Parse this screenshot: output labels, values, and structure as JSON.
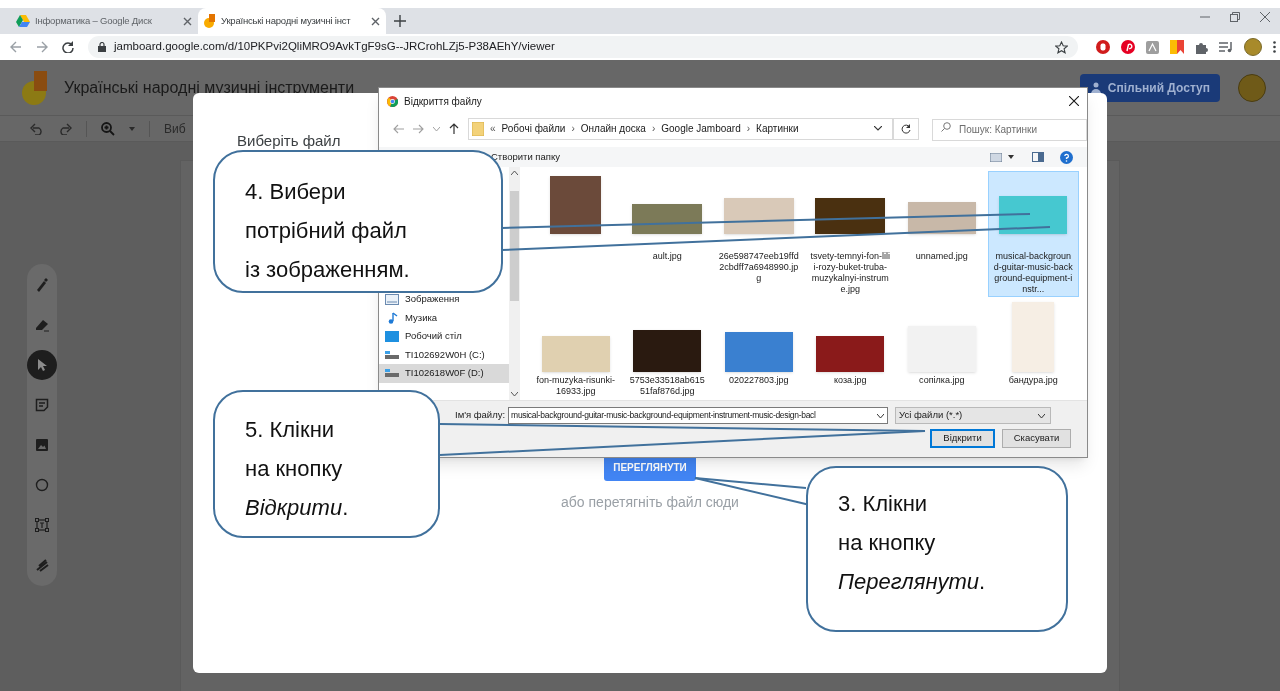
{
  "browser": {
    "tabs": [
      {
        "title": "Інформатика – Google Диск",
        "selected": false
      },
      {
        "title": "Українські народні музичні інст",
        "selected": true
      }
    ],
    "url": "jamboard.google.com/d/10PKPvi2QliMRO9AvkTgF9sG--JRCrohLZj5-P38AEhY/viewer"
  },
  "jamboard": {
    "title": "Українські народні музичні інструменти",
    "share_button": "Спільний Доступ",
    "toolbar_text": "Виб",
    "tools": [
      {
        "kind": "pen",
        "selected": false
      },
      {
        "kind": "eraser",
        "selected": false
      },
      {
        "kind": "select",
        "selected": true
      },
      {
        "kind": "note",
        "selected": false
      },
      {
        "kind": "image",
        "selected": false
      },
      {
        "kind": "shape",
        "selected": false
      },
      {
        "kind": "textbox",
        "selected": false
      },
      {
        "kind": "laser",
        "selected": false
      }
    ]
  },
  "upload_modal": {
    "title": "Виберіть файл",
    "browse_button": "ПЕРЕГЛЯНУТИ",
    "drop_hint": "або перетягніть файл сюди"
  },
  "file_dialog": {
    "title": "Відкриття файлу",
    "overflow": "«",
    "separator": "›",
    "breadcrumb": [
      "Робочі файли",
      "Онлайн доска",
      "Google Jamboard",
      "Картинки"
    ],
    "search_placeholder": "Пошук: Картинки",
    "new_folder": "Створити папку",
    "nav_items": [
      {
        "kind": "pictures",
        "label": "Зображення",
        "selected": false
      },
      {
        "kind": "music",
        "label": "Музика",
        "selected": false
      },
      {
        "kind": "desktop",
        "label": "Робочий стіл",
        "selected": false
      },
      {
        "kind": "drive",
        "label": "TI102692W0H (C:)",
        "selected": false
      },
      {
        "kind": "drive",
        "label": "TI102618W0F (D:)",
        "selected": true
      }
    ],
    "files": [
      {
        "selected": false
      },
      {
        "name": "ault.jpg",
        "selected": false
      },
      {
        "name": "26e598747eeb19ffd2cbdff7a6948990.jpg",
        "selected": false
      },
      {
        "name": "tsvety-temnyi-fon-lilii-rozy-buket-truba-muzykalnyi-instrume.jpg",
        "selected": false
      },
      {
        "name": "unnamed.jpg",
        "selected": false
      },
      {
        "name": "musical-background-guitar-music-background-equipment-instr...",
        "selected": true
      },
      {
        "name": "fon-muzyka-risunki-16933.jpg",
        "selected": false
      },
      {
        "name": "5753e33518ab61551faf876d.jpg",
        "selected": false
      },
      {
        "name": "020227803.jpg",
        "selected": false
      },
      {
        "name": "коза.jpg",
        "selected": false
      },
      {
        "name": "сопілка.jpg",
        "selected": false
      },
      {
        "name": "бандура.jpg",
        "selected": false
      }
    ],
    "file_name_label": "Ім'я файлу:",
    "file_name_value": "musical-background-guitar-music-background-equipment-instrument-music-design-bacl",
    "file_type": "Усі файли (*.*)",
    "open_button": "Відкрити",
    "cancel_button": "Скасувати"
  },
  "callouts": [
    {
      "text": "4. Вибери\nпотрібний файл\nіз зображенням."
    },
    {
      "text": "5. Клікни\nна кнопку\n*Відкрити*."
    },
    {
      "text": "3. Клікни\nна кнопку\n*Переглянути*."
    }
  ]
}
